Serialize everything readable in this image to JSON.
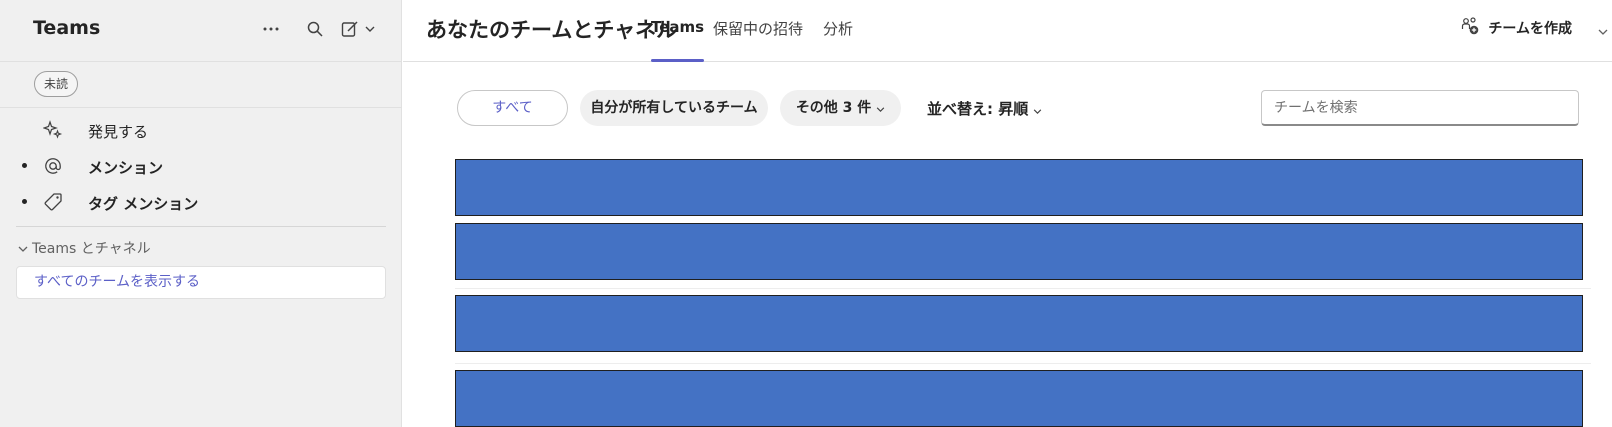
{
  "sidebar": {
    "title": "Teams",
    "filter_chip": "未読",
    "nav_items": [
      {
        "label": "発見する",
        "icon": "discover-sparkle-icon",
        "bold": false,
        "bullet": false
      },
      {
        "label": "メンション",
        "icon": "at-mention-icon",
        "bold": true,
        "bullet": true
      },
      {
        "label": "タグ メンション",
        "icon": "tag-icon",
        "bold": true,
        "bullet": true
      }
    ],
    "section_header": "Teams とチャネル",
    "show_all_link": "すべてのチームを表示する"
  },
  "header": {
    "page_title": "あなたのチームとチャネル",
    "tabs": [
      {
        "label": "Teams",
        "active": true
      },
      {
        "label": "保留中の招待",
        "active": false
      },
      {
        "label": "分析",
        "active": false
      }
    ],
    "create_team_label": "チームを作成"
  },
  "filters": {
    "all_label": "すべて",
    "owned_label": "自分が所有しているチーム",
    "more_label": "その他 3 件",
    "sort_label": "並べ替え: 昇順"
  },
  "search": {
    "placeholder": "チームを検索",
    "value": ""
  },
  "team_rows_count": 4,
  "colors": {
    "accent": "#5b5fc7",
    "redaction_block": "#4472c4",
    "sidebar_bg": "#f0f0f0"
  }
}
